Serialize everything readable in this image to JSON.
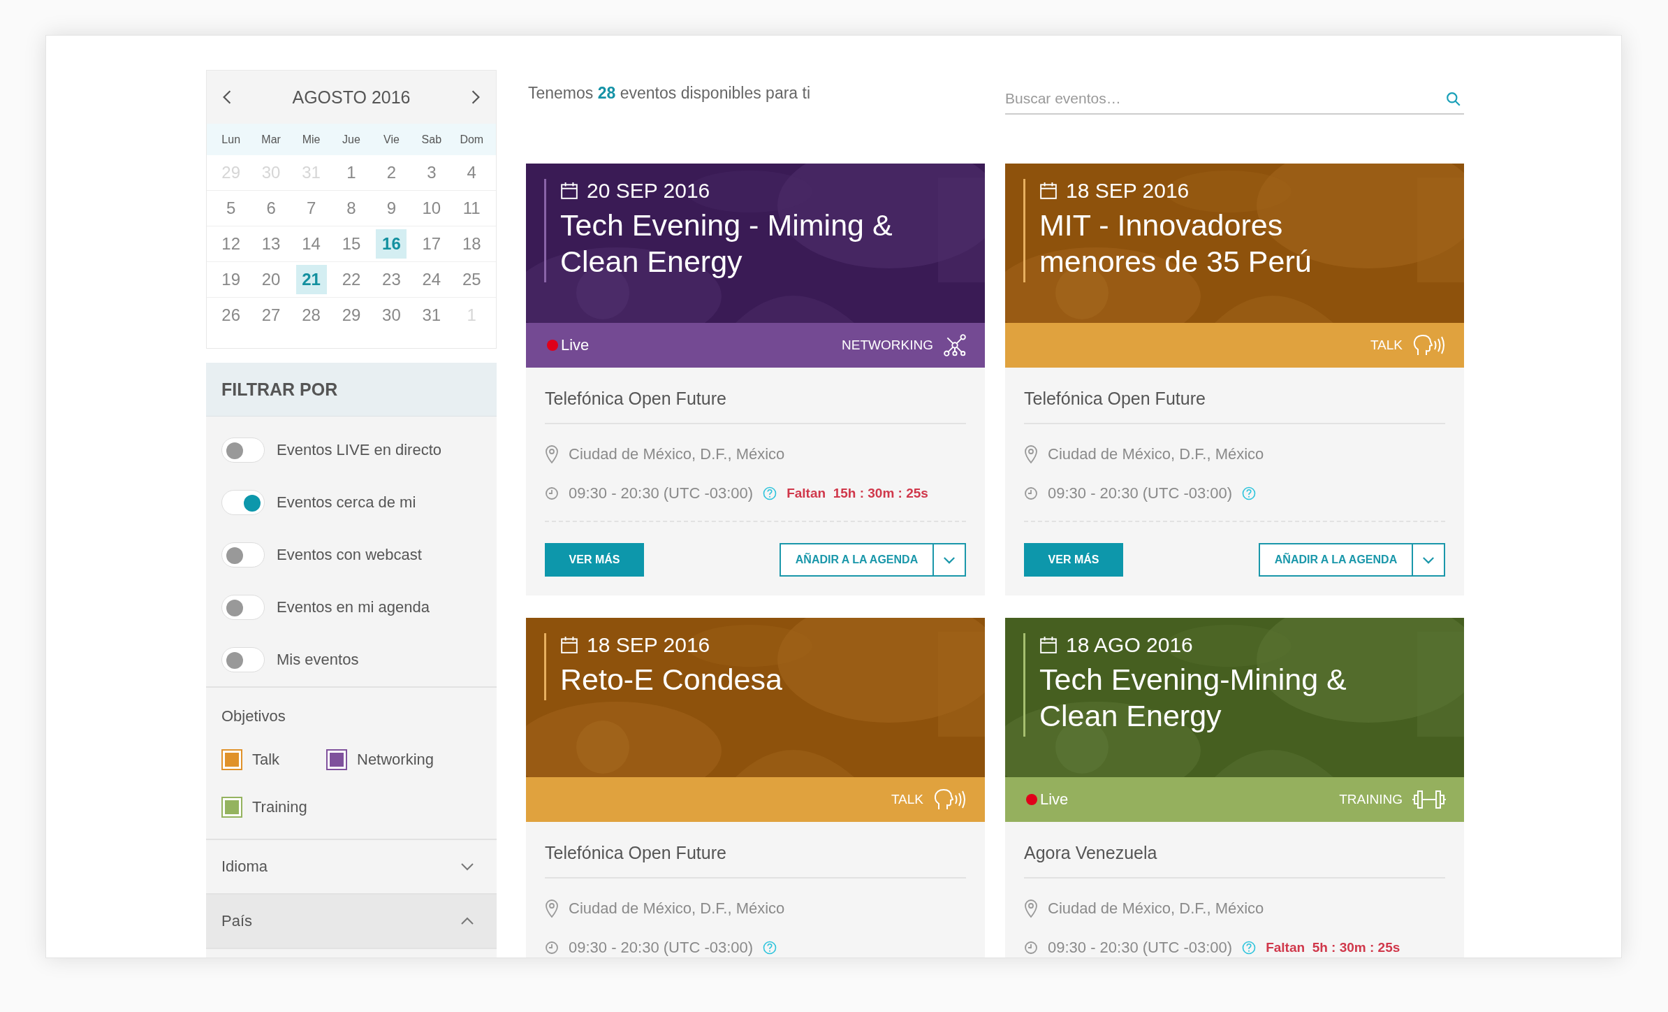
{
  "calendar": {
    "month": "AGOSTO 2016",
    "weekdays": [
      "Lun",
      "Mar",
      "Mie",
      "Jue",
      "Vie",
      "Sab",
      "Dom"
    ],
    "weeks": [
      [
        {
          "day": "29",
          "muted": true,
          "selected": false
        },
        {
          "day": "30",
          "muted": true,
          "selected": false
        },
        {
          "day": "31",
          "muted": true,
          "selected": false
        },
        {
          "day": "1",
          "muted": false,
          "selected": false
        },
        {
          "day": "2",
          "muted": false,
          "selected": false
        },
        {
          "day": "3",
          "muted": false,
          "selected": false
        },
        {
          "day": "4",
          "muted": false,
          "selected": false
        }
      ],
      [
        {
          "day": "5",
          "muted": false,
          "selected": false
        },
        {
          "day": "6",
          "muted": false,
          "selected": false
        },
        {
          "day": "7",
          "muted": false,
          "selected": false
        },
        {
          "day": "8",
          "muted": false,
          "selected": false
        },
        {
          "day": "9",
          "muted": false,
          "selected": false
        },
        {
          "day": "10",
          "muted": false,
          "selected": false
        },
        {
          "day": "11",
          "muted": false,
          "selected": false
        }
      ],
      [
        {
          "day": "12",
          "muted": false,
          "selected": false
        },
        {
          "day": "13",
          "muted": false,
          "selected": false
        },
        {
          "day": "14",
          "muted": false,
          "selected": false
        },
        {
          "day": "15",
          "muted": false,
          "selected": false
        },
        {
          "day": "16",
          "muted": false,
          "selected": true
        },
        {
          "day": "17",
          "muted": false,
          "selected": false
        },
        {
          "day": "18",
          "muted": false,
          "selected": false
        }
      ],
      [
        {
          "day": "19",
          "muted": false,
          "selected": false
        },
        {
          "day": "20",
          "muted": false,
          "selected": false
        },
        {
          "day": "21",
          "muted": false,
          "selected": true
        },
        {
          "day": "22",
          "muted": false,
          "selected": false
        },
        {
          "day": "23",
          "muted": false,
          "selected": false
        },
        {
          "day": "24",
          "muted": false,
          "selected": false
        },
        {
          "day": "25",
          "muted": false,
          "selected": false
        }
      ],
      [
        {
          "day": "26",
          "muted": false,
          "selected": false
        },
        {
          "day": "27",
          "muted": false,
          "selected": false
        },
        {
          "day": "28",
          "muted": false,
          "selected": false
        },
        {
          "day": "29",
          "muted": false,
          "selected": false
        },
        {
          "day": "30",
          "muted": false,
          "selected": false
        },
        {
          "day": "31",
          "muted": false,
          "selected": false
        },
        {
          "day": "1",
          "muted": true,
          "selected": false
        }
      ]
    ]
  },
  "filters": {
    "title": "FILTRAR POR",
    "toggles": [
      {
        "label": "Eventos LIVE en directo",
        "on": false
      },
      {
        "label": "Eventos cerca de mi",
        "on": true
      },
      {
        "label": "Eventos con webcast",
        "on": false
      },
      {
        "label": "Eventos en mi agenda",
        "on": false
      },
      {
        "label": "Mis eventos",
        "on": false
      }
    ],
    "objectives": {
      "title": "Objetivos",
      "items": [
        {
          "label": "Talk",
          "color": "#e0922a"
        },
        {
          "label": "Networking",
          "color": "#7f519c"
        },
        {
          "label": "Training",
          "color": "#94b35f"
        }
      ]
    },
    "sections": [
      {
        "label": "Idioma",
        "expanded": false
      },
      {
        "label": "País",
        "expanded": true
      }
    ]
  },
  "header": {
    "summary": "Tenemos **28** eventos disponibles para ti",
    "search": {
      "placeholder": "Buscar eventos…"
    }
  },
  "events": [
    {
      "date": "20 SEP 2016",
      "title": "Tech Evening - Miming & Clean Energy",
      "live": true,
      "live_label": "Live",
      "category": "NETWORKING",
      "kind": "networking",
      "organizer": "Telefónica Open Future",
      "location": "Ciudad de México, D.F., México",
      "time": "09:30 - 20:30 (UTC -03:00)",
      "countdown": "Faltan  15h : 30m : 25s",
      "buttons": {
        "primary": "VER MÁS",
        "secondary": "AÑADIR A LA AGENDA"
      }
    },
    {
      "date": "18 SEP 2016",
      "title": "MIT - Innovadores menores de 35 Perú",
      "live": false,
      "category": "TALK",
      "kind": "talk",
      "organizer": "Telefónica Open Future",
      "location": "Ciudad de México, D.F., México",
      "time": "09:30 - 20:30 (UTC -03:00)",
      "buttons": {
        "primary": "VER MÁS",
        "secondary": "AÑADIR A LA AGENDA"
      }
    },
    {
      "date": "18 SEP 2016",
      "title": "Reto-E Condesa",
      "live": false,
      "category": "TALK",
      "kind": "talk",
      "organizer": "Telefónica Open Future",
      "location": "Ciudad de México, D.F., México",
      "time": "09:30 - 20:30 (UTC -03:00)"
    },
    {
      "date": "18 AGO 2016",
      "title": "Tech Evening-Mining & Clean Energy",
      "live": true,
      "live_label": "Live",
      "category": "TRAINING",
      "kind": "training",
      "organizer": "Agora Venezuela",
      "location": "Ciudad de México, D.F., México",
      "time": "09:30 - 20:30 (UTC -03:00)",
      "countdown": "Faltan  5h : 30m : 25s"
    }
  ]
}
